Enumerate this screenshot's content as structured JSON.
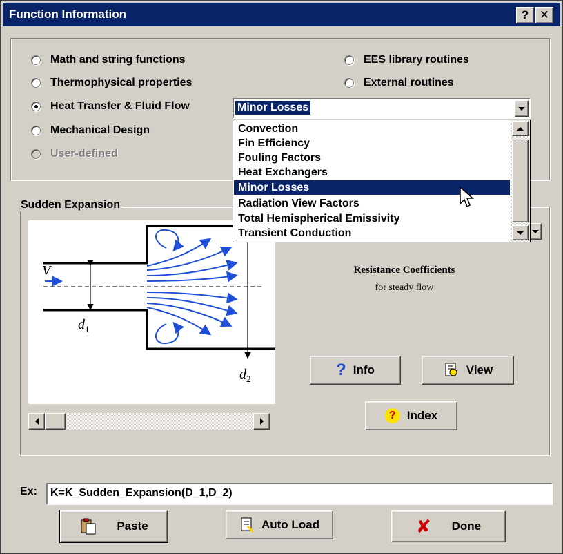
{
  "window": {
    "title": "Function Information",
    "help_button": "?",
    "close_button": "✕"
  },
  "categories": {
    "options": [
      {
        "label": "Math and string functions",
        "checked": false,
        "disabled": false
      },
      {
        "label": "Thermophysical properties",
        "checked": false,
        "disabled": false
      },
      {
        "label": "Heat Transfer & Fluid Flow",
        "checked": true,
        "disabled": false
      },
      {
        "label": "Mechanical Design",
        "checked": false,
        "disabled": false
      },
      {
        "label": "User-defined",
        "checked": false,
        "disabled": true
      },
      {
        "label": "EES library routines",
        "checked": false,
        "disabled": false
      },
      {
        "label": "External routines",
        "checked": false,
        "disabled": false
      }
    ]
  },
  "topic_select": {
    "value": "Minor Losses",
    "options": [
      "Convection",
      "Fin Efficiency",
      "Fouling Factors",
      "Heat Exchangers",
      "Minor Losses",
      "Radiation View Factors",
      "Total Hemispherical Emissivity",
      "Transient Conduction"
    ],
    "selected_index": 4
  },
  "function_group": {
    "title": "Sudden Expansion",
    "description_title": "Resistance Coefficients",
    "description_sub": "for steady flow",
    "diagram_labels": {
      "velocity": "V",
      "d1": "d",
      "d1_sub": "1",
      "d2": "d",
      "d2_sub": "2"
    },
    "info_button": "Info",
    "view_button": "View",
    "index_button": "Index"
  },
  "example": {
    "label": "Ex:",
    "value": "K=K_Sudden_Expansion(D_1,D_2)"
  },
  "footer": {
    "paste_button": "Paste",
    "autoload_button": "Auto Load",
    "done_button": "Done"
  },
  "colors": {
    "selection": "#0a246a",
    "face": "#d4d0c8",
    "flow_arrows": "#1f4fd6",
    "done_x": "#cc0000"
  }
}
